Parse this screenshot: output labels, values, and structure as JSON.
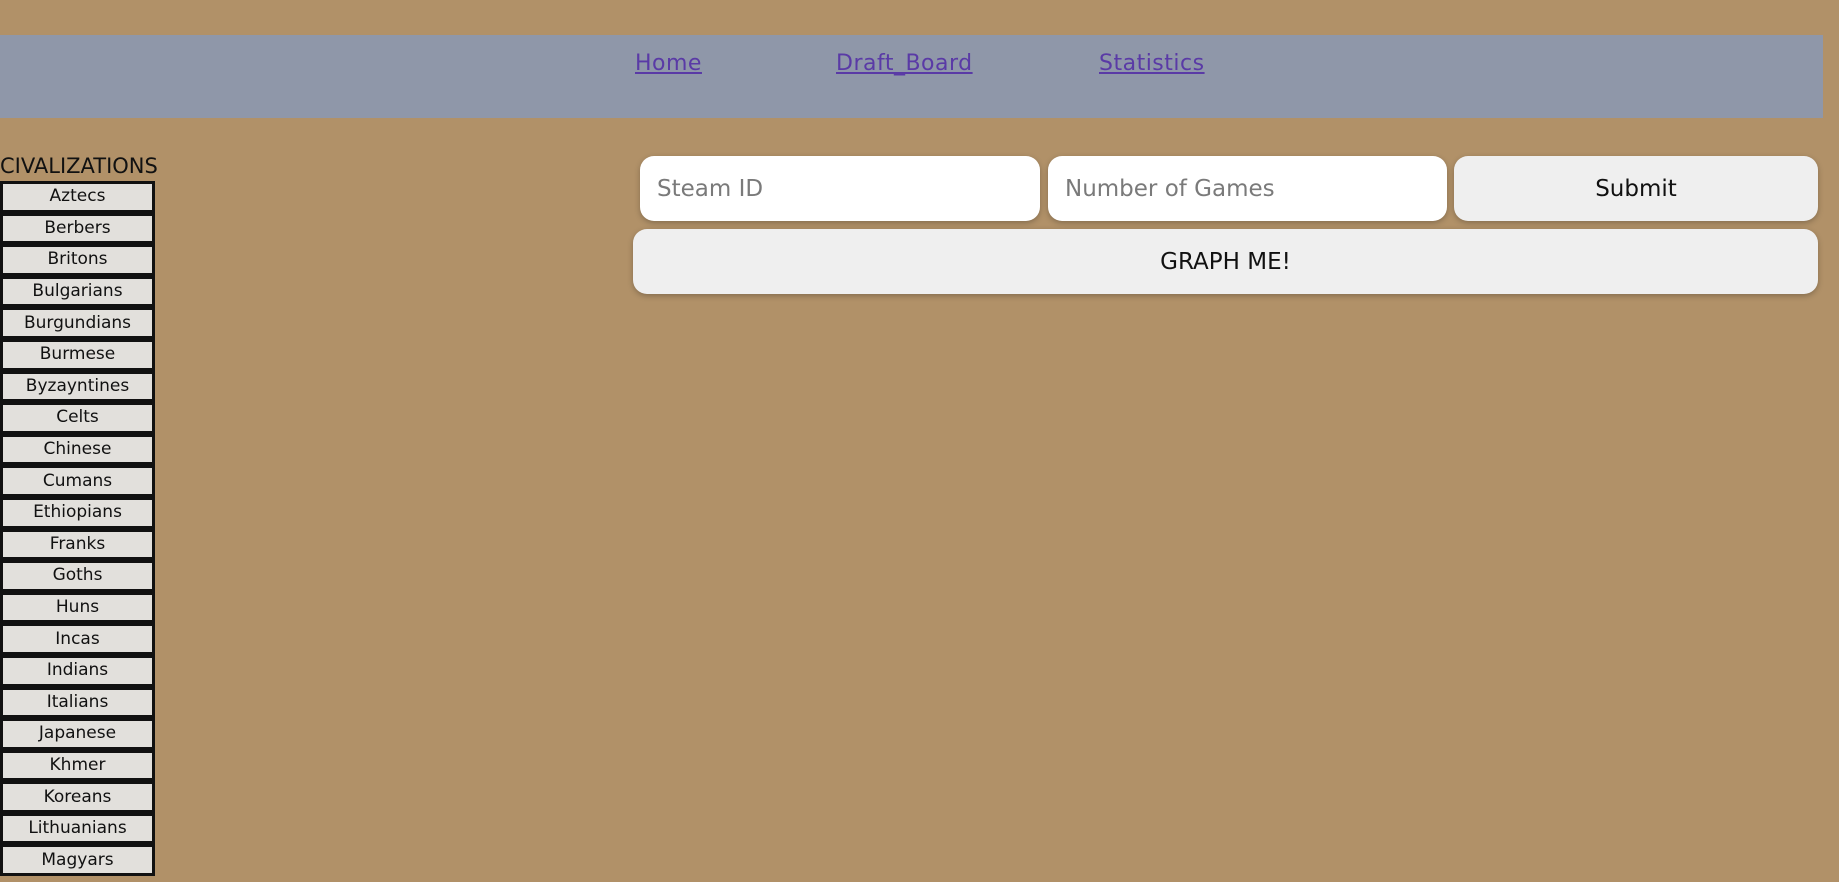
{
  "nav": {
    "links": [
      {
        "label": "Home"
      },
      {
        "label": "Draft_Board"
      },
      {
        "label": "Statistics"
      }
    ]
  },
  "sidebar": {
    "heading": "CIVALIZATIONS",
    "items": [
      {
        "label": "Aztecs"
      },
      {
        "label": "Berbers"
      },
      {
        "label": "Britons"
      },
      {
        "label": "Bulgarians"
      },
      {
        "label": "Burgundians"
      },
      {
        "label": "Burmese"
      },
      {
        "label": "Byzayntines"
      },
      {
        "label": "Celts"
      },
      {
        "label": "Chinese"
      },
      {
        "label": "Cumans"
      },
      {
        "label": "Ethiopians"
      },
      {
        "label": "Franks"
      },
      {
        "label": "Goths"
      },
      {
        "label": "Huns"
      },
      {
        "label": "Incas"
      },
      {
        "label": "Indians"
      },
      {
        "label": "Italians"
      },
      {
        "label": "Japanese"
      },
      {
        "label": "Khmer"
      },
      {
        "label": "Koreans"
      },
      {
        "label": "Lithuanians"
      },
      {
        "label": "Magyars"
      }
    ]
  },
  "form": {
    "steam_id": {
      "value": "",
      "placeholder": "Steam ID"
    },
    "num_games": {
      "value": "",
      "placeholder": "Number of Games"
    },
    "submit_label": "Submit",
    "graph_label": "GRAPH ME!"
  },
  "colors": {
    "background": "#b19168",
    "navbar": "#8f97a9",
    "link": "#5a3aa6",
    "button": "#efefef",
    "civ_button": "#e2e0dc"
  }
}
